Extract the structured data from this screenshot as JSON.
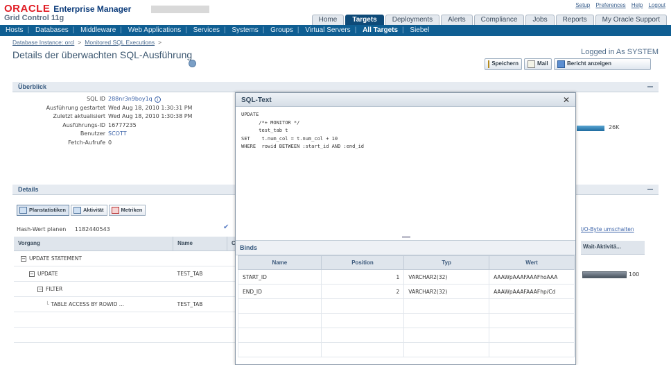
{
  "brand": {
    "oracle": "ORACLE",
    "product": "Enterprise Manager",
    "subtitle": "Grid Control 11g"
  },
  "global_links": [
    "Setup",
    "Preferences",
    "Help",
    "Logout"
  ],
  "tabs": [
    "Home",
    "Targets",
    "Deployments",
    "Alerts",
    "Compliance",
    "Jobs",
    "Reports",
    "My Oracle Support"
  ],
  "subnav": [
    "Hosts",
    "Databases",
    "Middleware",
    "Web Applications",
    "Services",
    "Systems",
    "Groups",
    "Virtual Servers",
    "All Targets",
    "Siebel"
  ],
  "breadcrumb": [
    "Database Instance: orcl",
    "Monitored SQL Executions"
  ],
  "page_title": "Details der überwachten SQL-Ausführung",
  "logged_in": "Logged in As SYSTEM",
  "buttons": {
    "save": "Speichern",
    "mail": "Mail",
    "report": "Bericht anzeigen"
  },
  "overview": {
    "title": "Überblick",
    "labels": [
      "SQL ID",
      "Ausführung gestartet",
      "Zuletzt aktualisiert",
      "Ausführungs-ID",
      "Benutzer",
      "Fetch-Aufrufe"
    ],
    "values": [
      "288nr3n9boy1q",
      "Wed Aug 18, 2010 1:30:31 PM",
      "Wed Aug 18, 2010 1:30:38 PM",
      "16777235",
      "SCOTT",
      "0"
    ],
    "right_value": "26K"
  },
  "details": {
    "title": "Details",
    "tabs": [
      "Planstatistiken",
      "Aktivität",
      "Metriken"
    ],
    "hash_label": "Hash-Wert planen",
    "hash_value": "1182440543",
    "io_text": "I/O-Byte umschalten",
    "columns": [
      "Vorgang",
      "Name",
      "C"
    ],
    "rows": [
      {
        "op": "UPDATE STATEMENT",
        "name": ""
      },
      {
        "op": "UPDATE",
        "name": "TEST_TAB"
      },
      {
        "op": "FILTER",
        "name": ""
      },
      {
        "op": "TABLE ACCESS BY ROWID ...",
        "name": "TEST_TAB"
      }
    ],
    "right_col_header": "Wait-Aktivitä...",
    "right_bar_value": "100"
  },
  "dialog": {
    "title": "SQL-Text",
    "sql": "UPDATE\n      /*+ MONITOR */\n      test_tab t\nSET    t.num_col = t.num_col + 10\nWHERE  rowid BETWEEN :start_id AND :end_id",
    "binds_title": "Binds",
    "columns": [
      "Name",
      "Position",
      "Typ",
      "Wert"
    ],
    "rows": [
      {
        "name": "START_ID",
        "position": "1",
        "type": "VARCHAR2(32)",
        "value": "AAAWpAAAFAAAFhoAAA"
      },
      {
        "name": "END_ID",
        "position": "2",
        "type": "VARCHAR2(32)",
        "value": "AAAWpAAAFAAAFhp/Cd"
      }
    ]
  }
}
